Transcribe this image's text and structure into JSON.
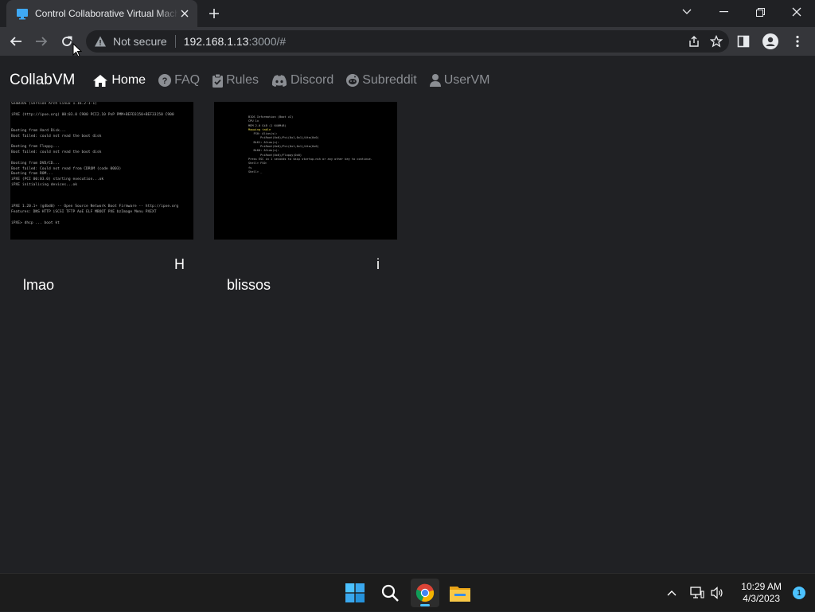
{
  "browser": {
    "tab_title": "Control Collaborative Virtual Machines!",
    "new_tab_icon": "plus-icon",
    "url_security": "Not secure",
    "url_host": "192.168.1.13",
    "url_rest": ":3000/#"
  },
  "site": {
    "brand": "CollabVM",
    "nav": [
      {
        "label": "Home",
        "icon": "home-icon"
      },
      {
        "label": "FAQ",
        "icon": "question-circle-icon"
      },
      {
        "label": "Rules",
        "icon": "clipboard-check-icon"
      },
      {
        "label": "Discord",
        "icon": "discord-icon"
      },
      {
        "label": "Subreddit",
        "icon": "reddit-icon"
      },
      {
        "label": "UserVM",
        "icon": "user-icon"
      }
    ]
  },
  "vms": [
    {
      "name": "lmao",
      "ghost_char": "H",
      "screen": [
        "SeaBIOS (version Arch Linux 1.16.2-1-1)",
        "",
        "iPXE (http://ipxe.org) 00:03.0 C900 PCI2.10 PnP PMM+BEFD3150+BEF33150 C900",
        "",
        "",
        "Booting from Hard Disk...",
        "Boot failed: could not read the boot disk",
        "",
        "Booting from Floppy...",
        "Boot failed: could not read the boot disk",
        "",
        "Booting from DVD/CD...",
        "Boot failed: Could not read from CDROM (code 0003)",
        "Booting from ROM...",
        "iPXE (PCI 00:03.0) starting execution...ok",
        "iPXE initialising devices...ok",
        "",
        "",
        "",
        "iPXE 1.20.1+ (g4bd0) -- Open Source Network Boot Firmware -- http://ipxe.org",
        "Features: DNS HTTP iSCSI TFTP AoE ELF MBOOT PXE bzImage Menu PXEXT",
        "",
        "iPXE> dhcp ... boot kt"
      ]
    },
    {
      "name": "blissos",
      "ghost_char": "i",
      "screen": [
        "BIOS Information (Boot v2)",
        "CPU 1x",
        "MEM 2.0 GiB (1 640MiB)",
        "Mapping table",
        "   FS0: Alias(s):",
        "       PciRoot(0x0)/Pci(0x1,0x1)/Ata(0x0)",
        "   BLK1: Alias(s):",
        "       PciRoot(0x0)/Pci(0x1,0x1)/Ata(0x0)",
        "   BLK0: Alias(s):",
        "       PciRoot(0x0)/Floppy(0x0)",
        "Press ESC in 1 seconds to skip startup.nsh or any other key to continue.",
        "Shell> FS0:",
        "fs",
        "Shell> _"
      ]
    }
  ],
  "taskbar": {
    "apps": [
      "windows-start-icon",
      "search-icon",
      "chrome-icon",
      "file-explorer-icon"
    ],
    "time": "10:29 AM",
    "date": "4/3/2023",
    "notification_count": "1"
  }
}
